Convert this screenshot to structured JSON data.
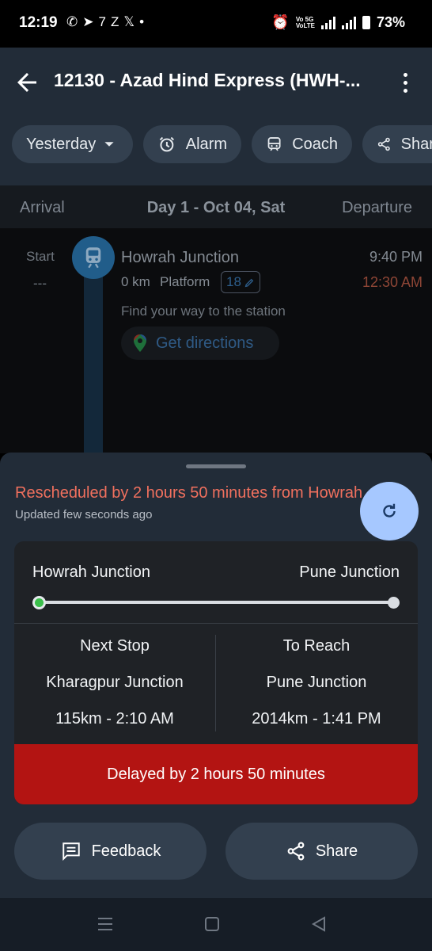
{
  "status_bar": {
    "time": "12:19",
    "notification_icons": [
      "whatsapp-icon",
      "telegram-icon",
      "app-icon",
      "z-icon",
      "x-icon",
      "dot-icon"
    ],
    "network_label": "Vo 5G\nVoLTE",
    "net_5g": "5G",
    "battery": "73%"
  },
  "app_bar": {
    "title": "12130 - Azad Hind Express (HWH-..."
  },
  "chips": {
    "date": "Yesterday",
    "alarm": "Alarm",
    "coach": "Coach",
    "share": "Share"
  },
  "day_header": {
    "arrival": "Arrival",
    "day": "Day 1 - Oct 04, Sat",
    "departure": "Departure"
  },
  "station": {
    "arrival_label": "Start",
    "arrival_time": "---",
    "name": "Howrah Junction",
    "distance": "0 km",
    "platform_label": "Platform",
    "platform": "18",
    "scheduled_departure": "9:40 PM",
    "actual_departure": "12:30 AM",
    "find_text": "Find your way to the station",
    "directions": "Get directions"
  },
  "sheet": {
    "rescheduled": "Rescheduled by 2 hours 50 minutes from Howrah Junction",
    "updated": "Updated few seconds ago",
    "route_from": "Howrah Junction",
    "route_to": "Pune Junction",
    "progress": 0,
    "next_stop_label": "Next Stop",
    "next_stop_name": "Kharagpur Junction",
    "next_stop_info": "115km - 2:10 AM",
    "to_reach_label": "To Reach",
    "to_reach_name": "Pune Junction",
    "to_reach_info": "2014km - 1:41 PM",
    "delay": "Delayed by 2 hours 50 minutes",
    "feedback": "Feedback",
    "share": "Share"
  },
  "colors": {
    "app_bar": "#222c38",
    "chip": "#33404f",
    "delay_red": "#b31412",
    "reschedule_text": "#f0705e",
    "fab": "#a6c8ff",
    "progress_start": "#3bbf4b"
  }
}
